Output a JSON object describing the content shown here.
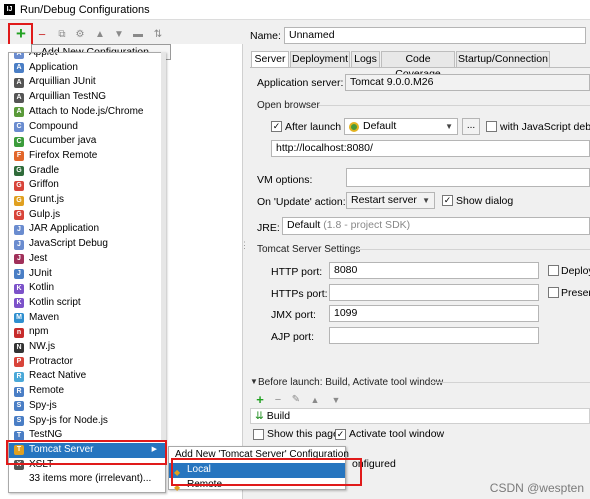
{
  "window": {
    "title": "Run/Debug Configurations"
  },
  "toolbar": {
    "add_tooltip": "Add New Configuration"
  },
  "menu": {
    "items": [
      {
        "label": "Applet",
        "icon": "applet-icon",
        "color": "#6a8ccf"
      },
      {
        "label": "Application",
        "icon": "application-icon",
        "color": "#4a7ec5"
      },
      {
        "label": "Arquillian JUnit",
        "icon": "arquillian-icon",
        "color": "#555555"
      },
      {
        "label": "Arquillian TestNG",
        "icon": "arquillian-icon",
        "color": "#555555"
      },
      {
        "label": "Attach to Node.js/Chrome",
        "icon": "nodejs-icon",
        "color": "#5a9a3a"
      },
      {
        "label": "Compound",
        "icon": "compound-icon",
        "color": "#6a8ccf"
      },
      {
        "label": "Cucumber java",
        "icon": "cucumber-icon",
        "color": "#3b9c3b"
      },
      {
        "label": "Firefox Remote",
        "icon": "firefox-icon",
        "color": "#e2662a"
      },
      {
        "label": "Gradle",
        "icon": "gradle-icon",
        "color": "#2f6b3a"
      },
      {
        "label": "Griffon",
        "icon": "griffon-icon",
        "color": "#d8443a"
      },
      {
        "label": "Grunt.js",
        "icon": "grunt-icon",
        "color": "#e0a020"
      },
      {
        "label": "Gulp.js",
        "icon": "gulp-icon",
        "color": "#d8443a"
      },
      {
        "label": "JAR Application",
        "icon": "jar-icon",
        "color": "#6a8ccf"
      },
      {
        "label": "JavaScript Debug",
        "icon": "javascript-icon",
        "color": "#6a8ccf"
      },
      {
        "label": "Jest",
        "icon": "jest-icon",
        "color": "#a0305a"
      },
      {
        "label": "JUnit",
        "icon": "junit-icon",
        "color": "#4a7ec5"
      },
      {
        "label": "Kotlin",
        "icon": "kotlin-icon",
        "color": "#7c52c9"
      },
      {
        "label": "Kotlin script",
        "icon": "kotlin-icon",
        "color": "#7c52c9"
      },
      {
        "label": "Maven",
        "icon": "maven-icon",
        "color": "#2f8fcf"
      },
      {
        "label": "npm",
        "icon": "npm-icon",
        "color": "#c62b2b"
      },
      {
        "label": "NW.js",
        "icon": "nwjs-icon",
        "color": "#333333"
      },
      {
        "label": "Protractor",
        "icon": "protractor-icon",
        "color": "#d8443a"
      },
      {
        "label": "React Native",
        "icon": "react-icon",
        "color": "#4aa8d8"
      },
      {
        "label": "Remote",
        "icon": "remote-icon",
        "color": "#4a7ec5"
      },
      {
        "label": "Spy-js",
        "icon": "spyjs-icon",
        "color": "#4a7ec5"
      },
      {
        "label": "Spy-js for Node.js",
        "icon": "spyjs-icon",
        "color": "#4a7ec5"
      },
      {
        "label": "TestNG",
        "icon": "testng-icon",
        "color": "#4a7ec5"
      },
      {
        "label": "Tomcat Server",
        "icon": "tomcat-icon",
        "color": "#e0a020"
      },
      {
        "label": "XSLT",
        "icon": "xslt-icon",
        "color": "#555555"
      },
      {
        "label": "33 items more (irrelevant)...",
        "icon": "",
        "color": ""
      }
    ],
    "selected_index": 27
  },
  "submenu": {
    "header": "Add New 'Tomcat Server' Configuration",
    "items": [
      {
        "label": "Local",
        "icon": "tomcat-icon"
      },
      {
        "label": "Remote",
        "icon": "tomcat-icon"
      }
    ]
  },
  "form": {
    "name_label": "Name:",
    "name_value": "Unnamed",
    "tabs": [
      "Server",
      "Deployment",
      "Logs",
      "Code Coverage",
      "Startup/Connection"
    ],
    "active_tab": 0,
    "app_server_label": "Application server:",
    "app_server_value": "Tomcat 9.0.0.M26",
    "open_browser_label": "Open browser",
    "after_launch_label": "After launch",
    "after_launch_checked": "✓",
    "browser_value": "Default",
    "browse_button": "...",
    "js_debugger_label": "with JavaScript debugger",
    "url_value": "http://localhost:8080/",
    "vm_options_label": "VM options:",
    "on_update_label": "On 'Update' action:",
    "on_update_value": "Restart server",
    "show_dialog_label": "Show dialog",
    "show_dialog_checked": "✓",
    "jre_label": "JRE:",
    "jre_value": "Default",
    "jre_hint": "(1.8 - project SDK)",
    "tomcat_settings_label": "Tomcat Server Settings",
    "http_port_label": "HTTP port:",
    "http_port_value": "8080",
    "https_port_label": "HTTPs port:",
    "https_port_value": "",
    "jmx_port_label": "JMX port:",
    "jmx_port_value": "1099",
    "ajp_port_label": "AJP port:",
    "ajp_port_value": "",
    "deploy_label": "Deploy",
    "preserve_label": "Preserve",
    "before_launch_label": "Before launch: Build, Activate tool window",
    "build_item": "Build",
    "show_page_label": "Show this page",
    "activate_tool_label": "Activate tool window",
    "activate_tool_checked": "✓",
    "not_configured_text": "onfigured"
  },
  "watermark": "CSDN @wespten"
}
